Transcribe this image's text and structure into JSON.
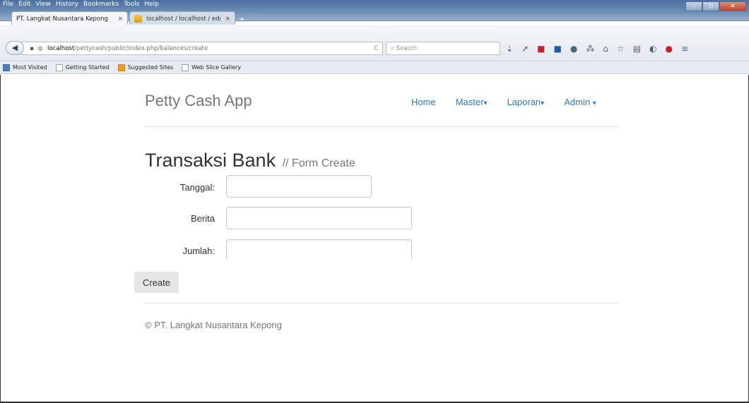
{
  "browser": {
    "menu": [
      "File",
      "Edit",
      "View",
      "History",
      "Bookmarks",
      "Tools",
      "Help"
    ],
    "window_controls": {
      "minimize": "–",
      "maximize": "▫",
      "close": "✕"
    },
    "tabs": [
      {
        "label": "PT. Langkat Nusantara Kepong",
        "close": "×"
      },
      {
        "label": "localhost / localhost / edg...",
        "close": "×"
      }
    ],
    "new_tab": "+",
    "url": {
      "host": "localhost",
      "path": "/pettycash/public/index.php/balances/create",
      "reload": "C"
    },
    "search_placeholder": "Search",
    "bookmarks": [
      {
        "label": "Most Visited",
        "icon": "bookmark-folder-icon"
      },
      {
        "label": "Getting Started",
        "icon": "page-icon"
      },
      {
        "label": "Suggested Sites",
        "icon": "suggested-sites-icon"
      },
      {
        "label": "Web Slice Gallery",
        "icon": "page-icon"
      }
    ]
  },
  "app": {
    "brand": "Petty Cash App",
    "nav": [
      {
        "label": "Home",
        "caret": ""
      },
      {
        "label": "Master",
        "caret": "▾"
      },
      {
        "label": "Laporan",
        "caret": "▾"
      },
      {
        "label": "Admin",
        "caret": "▾"
      }
    ],
    "heading": "Transaksi Bank",
    "subheading": "// Form Create",
    "form": {
      "tanggal_label": "Tanggal:",
      "tanggal_value": "",
      "berita_label": "Berita",
      "berita_value": "",
      "jumlah_label": "Jumlah:",
      "jumlah_value": ""
    },
    "create_button": "Create",
    "footer": "© PT. Langkat Nusantara Kepong"
  }
}
